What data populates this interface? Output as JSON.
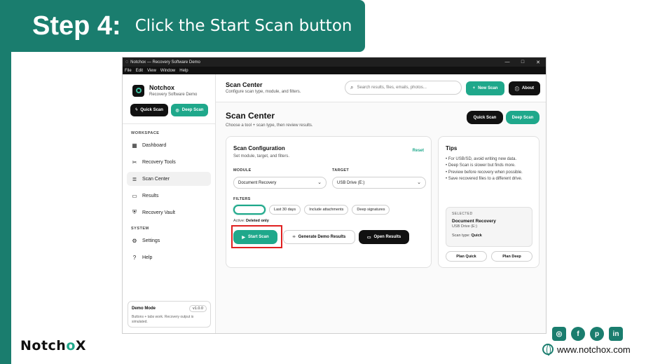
{
  "banner": {
    "step": "Step 4:",
    "instruction": "Click the Start Scan button"
  },
  "window": {
    "title": "Notchox — Recovery Software Demo",
    "menu": [
      "File",
      "Edit",
      "View",
      "Window",
      "Help"
    ],
    "controls": {
      "minimize": "—",
      "maximize": "□",
      "close": "✕"
    }
  },
  "sidebar": {
    "brand_name": "Notchox",
    "brand_sub": "Recovery Software Demo",
    "quick_scan": "Quick Scan",
    "deep_scan": "Deep Scan",
    "workspace_label": "WORKSPACE",
    "system_label": "SYSTEM",
    "items": [
      {
        "label": "Dashboard",
        "icon": "dashboard-icon",
        "glyph": "▦"
      },
      {
        "label": "Recovery Tools",
        "icon": "tools-icon",
        "glyph": "✂"
      },
      {
        "label": "Scan Center",
        "icon": "scan-icon",
        "glyph": "≣"
      },
      {
        "label": "Results",
        "icon": "folder-icon",
        "glyph": "▭"
      },
      {
        "label": "Recovery Vault",
        "icon": "shield-icon",
        "glyph": "⛨"
      },
      {
        "label": "Settings",
        "icon": "gear-icon",
        "glyph": "⚙"
      },
      {
        "label": "Help",
        "icon": "help-icon",
        "glyph": "?"
      }
    ],
    "demo": {
      "title": "Demo Mode",
      "version": "v1.0.0",
      "desc": "Buttons + tabs work. Recovery output is simulated."
    }
  },
  "topbar": {
    "title": "Scan Center",
    "subtitle": "Configure scan type, module, and filters.",
    "search_placeholder": "Search results, files, emails, photos...",
    "new_scan": "New Scan",
    "about": "About"
  },
  "main": {
    "title": "Scan Center",
    "subtitle": "Choose a tool + scan type, then review results.",
    "quick_scan": "Quick Scan",
    "deep_scan": "Deep Scan"
  },
  "config": {
    "title": "Scan Configuration",
    "subtitle": "Set module, target, and filters.",
    "reset": "Reset",
    "module_label": "MODULE",
    "module_value": "Document Recovery",
    "target_label": "TARGET",
    "target_value": "USB Drive (E:)",
    "filters_label": "FILTERS",
    "chips": [
      "",
      "Last 30 days",
      "Include attachments",
      "Deep signatures"
    ],
    "active_prefix": "Active:",
    "active_value": "Deleted only",
    "start_scan": "Start Scan",
    "generate": "Generate Demo Results",
    "open_results": "Open Results"
  },
  "tips": {
    "title": "Tips",
    "items": [
      "• For USB/SD, avoid writing new data.",
      "• Deep Scan is slower but finds more.",
      "• Preview before recovery when possible.",
      "• Save recovered files to a different drive."
    ],
    "selected_label": "SELECTED",
    "selected_name": "Document Recovery",
    "selected_drive": "USB Drive (E:)",
    "scan_type_label": "Scan type:",
    "scan_type_value": "Quick",
    "plan_quick": "Plan Quick",
    "plan_deep": "Plan Deep"
  },
  "footer": {
    "logo_a": "Notch",
    "logo_x": "o",
    "logo_b": "X",
    "website": "www.notchox.com"
  },
  "colors": {
    "brand": "#1a7d6e",
    "accent": "#1fa88b",
    "highlight": "#e02020"
  }
}
